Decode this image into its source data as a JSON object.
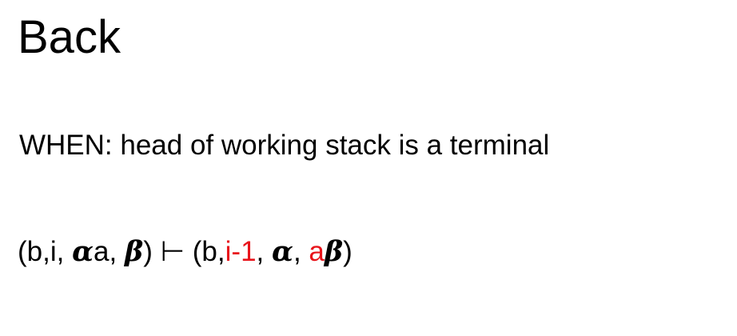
{
  "slide": {
    "title": "Back",
    "condition": "WHEN: head of working stack is a terminal",
    "formula": {
      "lhs_open": "(b,i, ",
      "lhs_alpha": "α",
      "lhs_a": "a, ",
      "lhs_beta": "β",
      "lhs_close": ")",
      "turnstile": " ⊢ ",
      "rhs_open": "(b,",
      "rhs_index": "i-1",
      "rhs_sep1": ", ",
      "rhs_alpha": "α",
      "rhs_sep2": ", ",
      "rhs_a": "a",
      "rhs_beta": "β",
      "rhs_close": ")"
    },
    "colors": {
      "text": "#000000",
      "highlight": "#e8141b",
      "background": "#ffffff"
    }
  }
}
